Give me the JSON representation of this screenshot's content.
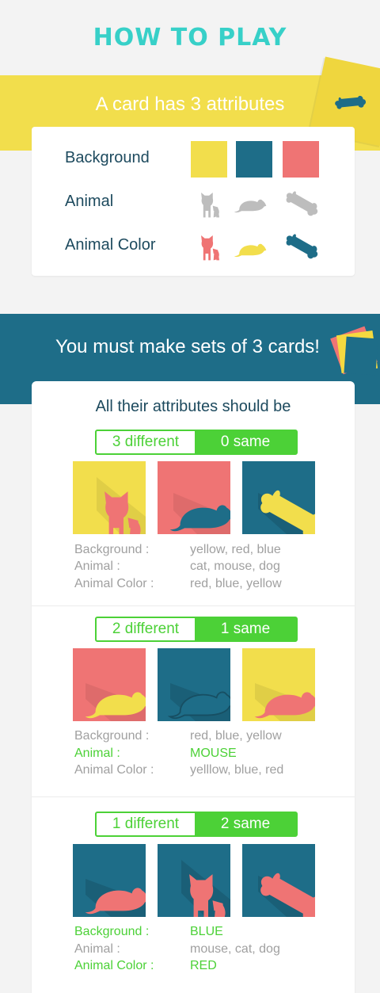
{
  "title": "HOW TO PLAY",
  "intro": {
    "heading": "A card has 3 attributes",
    "attributes": [
      {
        "label": "Background"
      },
      {
        "label": "Animal"
      },
      {
        "label": "Animal Color"
      }
    ],
    "colors": {
      "yellow": "#f2de4c",
      "blue": "#1e6d88",
      "red": "#ef7474",
      "grey": "#bdbdbd"
    }
  },
  "rule": {
    "heading": "You must make sets of 3 cards!",
    "subheading": "All their attributes should be",
    "examples": [
      {
        "diff_label": "3 different",
        "same_label": "0 same",
        "tiles": [
          {
            "bg": "yellow",
            "animal": "cat",
            "color": "red"
          },
          {
            "bg": "red",
            "animal": "mouse",
            "color": "blue"
          },
          {
            "bg": "blue",
            "animal": "dog",
            "color": "yellow"
          }
        ],
        "rows": [
          {
            "label": "Background :",
            "value": "yellow, red, blue"
          },
          {
            "label": "Animal :",
            "value": "cat, mouse, dog"
          },
          {
            "label": "Animal Color :",
            "value": "red, blue, yellow"
          }
        ]
      },
      {
        "diff_label": "2 different",
        "same_label": "1 same",
        "tiles": [
          {
            "bg": "red",
            "animal": "mouse",
            "color": "yellow"
          },
          {
            "bg": "blue",
            "animal": "mouse",
            "color": "blue"
          },
          {
            "bg": "yellow",
            "animal": "mouse",
            "color": "red"
          }
        ],
        "rows": [
          {
            "label": "Background :",
            "value": "red, blue, yellow"
          },
          {
            "label": "Animal :",
            "value": "MOUSE"
          },
          {
            "label": "Animal Color :",
            "value": "yelllow, blue, red"
          }
        ]
      },
      {
        "diff_label": "1 different",
        "same_label": "2 same",
        "tiles": [
          {
            "bg": "blue",
            "animal": "mouse",
            "color": "red"
          },
          {
            "bg": "blue",
            "animal": "cat",
            "color": "red"
          },
          {
            "bg": "blue",
            "animal": "dog",
            "color": "red"
          }
        ],
        "rows": [
          {
            "label": "Background :",
            "value": "BLUE"
          },
          {
            "label": "Animal :",
            "value": "mouse, cat, dog"
          },
          {
            "label": "Animal Color :",
            "value": "RED"
          }
        ]
      }
    ]
  }
}
